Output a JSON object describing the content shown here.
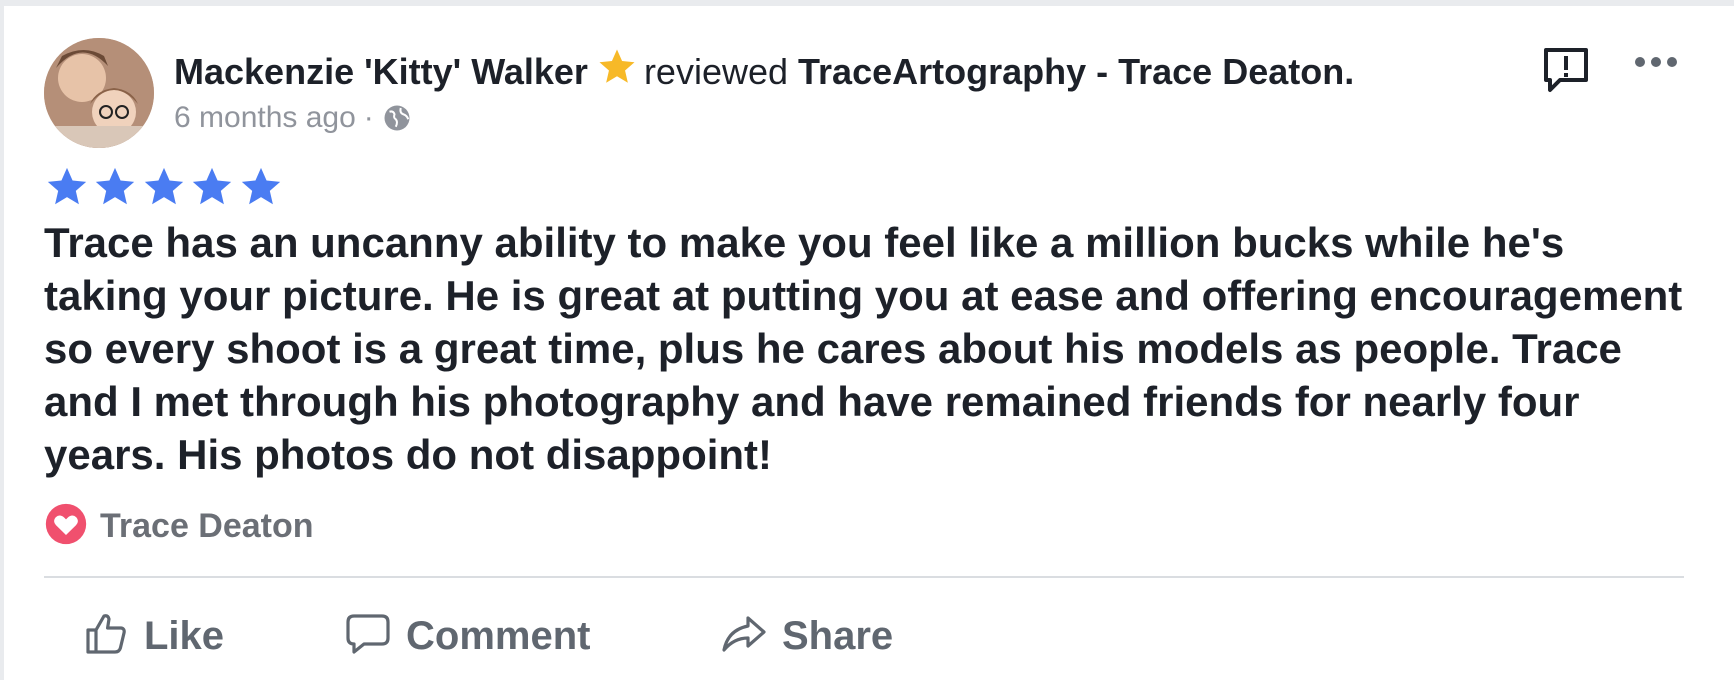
{
  "post": {
    "author": "Mackenzie 'Kitty' Walker",
    "verb": "reviewed",
    "page": "TraceArtography - Trace Deaton.",
    "time": "6 months ago",
    "separator": "·",
    "audience_icon": "globe-icon",
    "badge_icon": "top-fan-star-icon",
    "badge_color": "#f7b928"
  },
  "rating": {
    "stars": 5,
    "max": 5,
    "color": "#4a7cf2"
  },
  "review": {
    "text": "Trace has an uncanny ability to make you feel like a million bucks while he's taking your picture. He is great at putting you at ease and offering encouragement so every shoot is a great time, plus he cares about his models as people. Trace and I met through his photography and have remained friends for nearly four years. His photos do not disappoint!"
  },
  "reaction": {
    "icon": "love-reaction-icon",
    "name": "Trace Deaton",
    "color": "#f0506e"
  },
  "actions": {
    "like": "Like",
    "comment": "Comment",
    "share": "Share"
  }
}
